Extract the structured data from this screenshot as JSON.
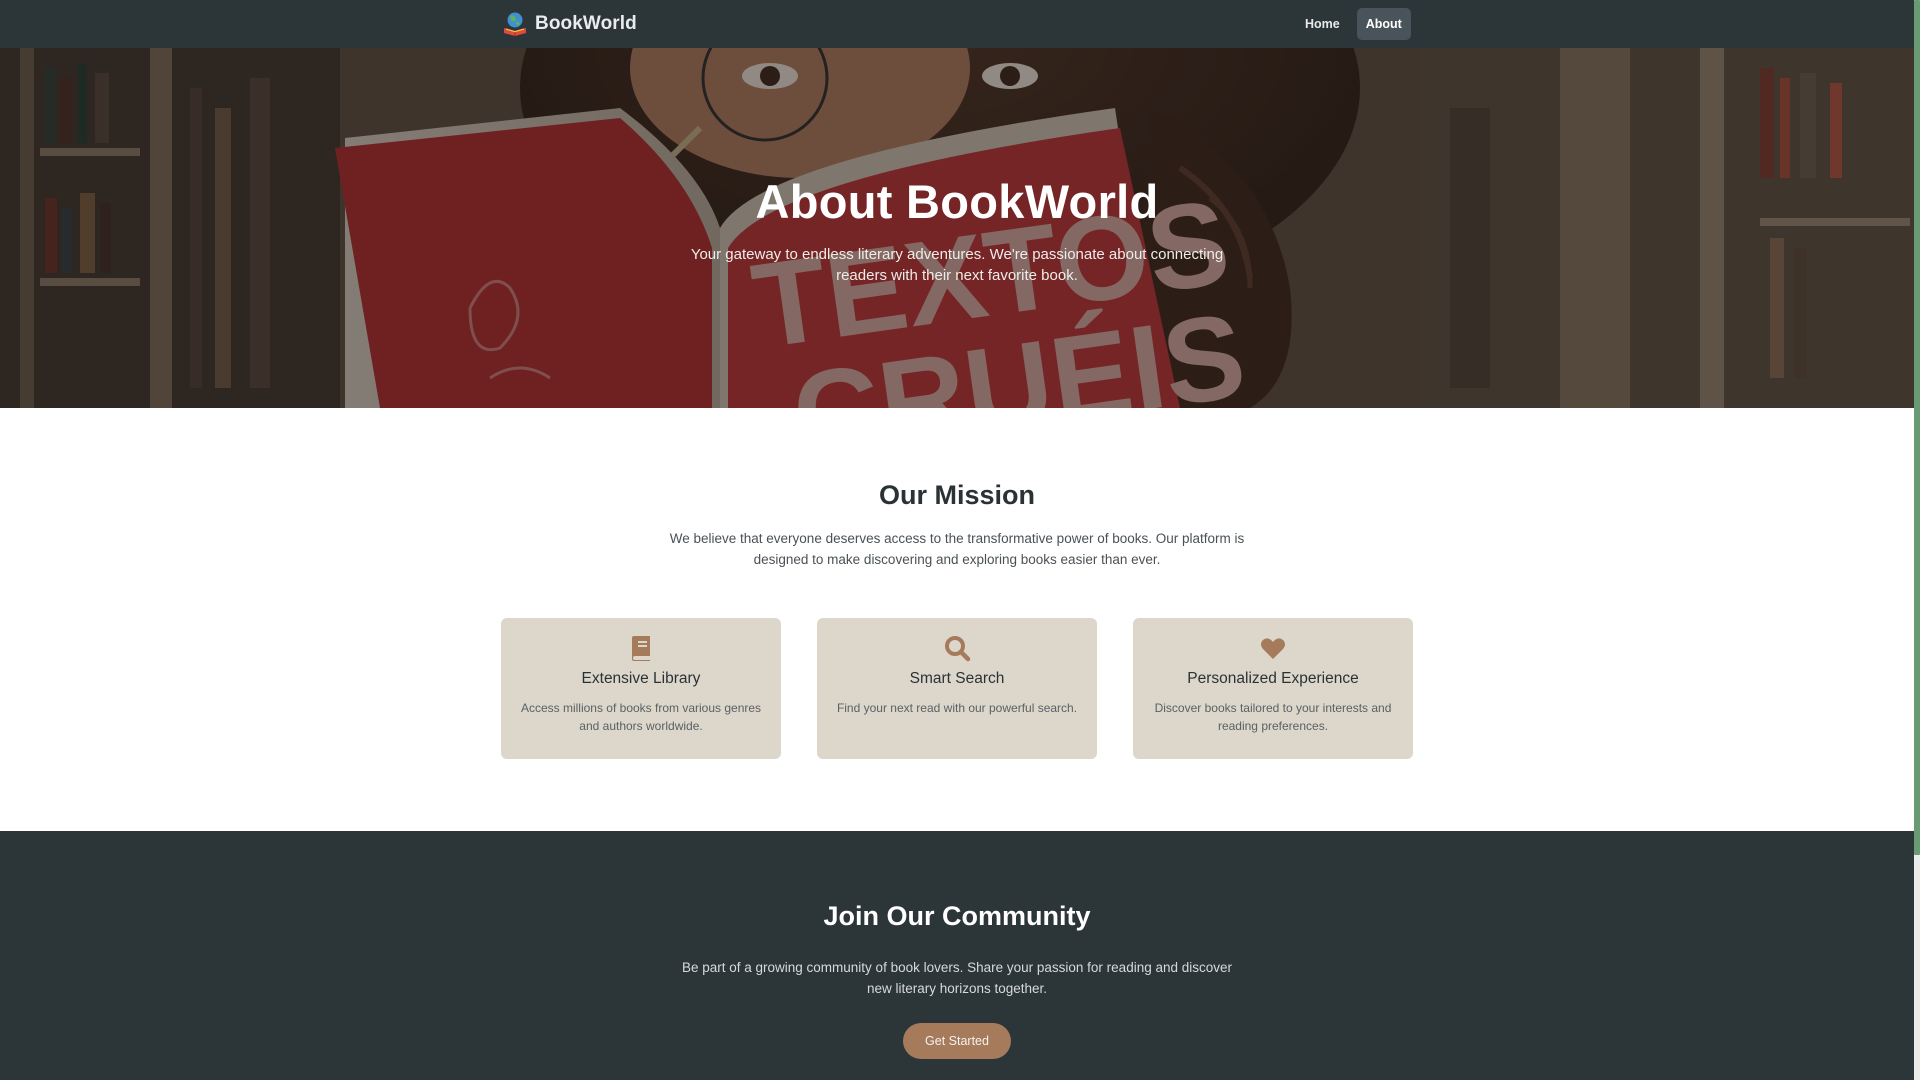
{
  "nav": {
    "brand": "BookWorld",
    "logo_icon": "globe-book-icon",
    "links": [
      {
        "label": "Home",
        "active": false
      },
      {
        "label": "About",
        "active": true
      }
    ]
  },
  "hero": {
    "title": "About BookWorld",
    "subtitle": "Your gateway to endless literary adventures. We're passionate about connecting readers with their next favorite book.",
    "background": "photo of a woman with glasses reading a red book titled TEXTOS CRUÉIS in a library"
  },
  "mission": {
    "title": "Our Mission",
    "text": "We believe that everyone deserves access to the transformative power of books. Our platform is designed to make discovering and exploring books easier than ever.",
    "features": [
      {
        "icon": "book-icon",
        "title": "Extensive Library",
        "desc": "Access millions of books from various genres and authors worldwide."
      },
      {
        "icon": "search-icon",
        "title": "Smart Search",
        "desc": "Find your next read with our powerful search."
      },
      {
        "icon": "heart-icon",
        "title": "Personalized Experience",
        "desc": "Discover books tailored to your interests and reading preferences."
      }
    ]
  },
  "community": {
    "title": "Join Our Community",
    "text": "Be part of a growing community of book lovers. Share your passion for reading and discover new literary horizons together.",
    "button": "Get Started"
  },
  "colors": {
    "nav_bg": "#2c3538",
    "card_bg": "#ddd6ca",
    "accent": "#a57b5c",
    "heading": "#2b3236"
  }
}
